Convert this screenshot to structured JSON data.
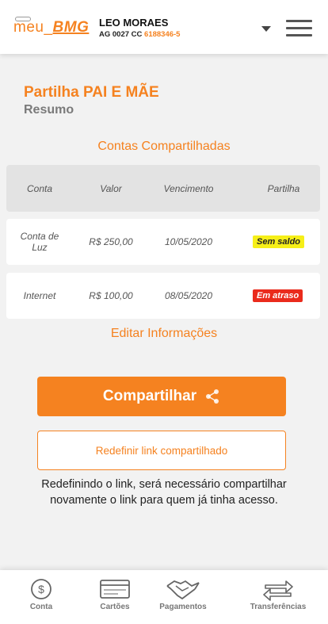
{
  "header": {
    "logo_text_a": "meu_",
    "logo_text_b": "BMG",
    "user_name": "LEO MORAES",
    "agency": "AG 0027 CC",
    "account": "6188346-5"
  },
  "page": {
    "title": "Partilha PAI E MÃE",
    "subtitle": "Resumo",
    "section_title": "Contas Compartilhadas"
  },
  "table": {
    "headers": [
      "Conta",
      "Valor",
      "Vencimento",
      "Partilha"
    ],
    "rows": [
      {
        "conta": "Conta de Luz",
        "valor": "R$ 250,00",
        "vencimento": "10/05/2020",
        "status": "Sem saldo"
      },
      {
        "conta": "Internet",
        "valor": "R$ 100,00",
        "vencimento": "08/05/2020",
        "status": "Em atraso"
      }
    ]
  },
  "actions": {
    "edit_label": "Editar Informações",
    "share_label": "Compartilhar",
    "reset_label": "Redefinir link compartilhado",
    "notice": "Redefinindo o link, será necessário compartilhar novamente o link para quem já tinha acesso."
  },
  "nav": {
    "items": [
      {
        "label": "Conta",
        "icon": "dollar-circle-icon"
      },
      {
        "label": "Cartões",
        "icon": "card-icon"
      },
      {
        "label": "Pagamentos",
        "icon": "handshake-icon"
      },
      {
        "label": "Transferências",
        "icon": "transfer-arrows-icon"
      }
    ]
  },
  "colors": {
    "accent": "#f58220",
    "warning": "#f6ef18",
    "danger": "#ea2b1c"
  }
}
